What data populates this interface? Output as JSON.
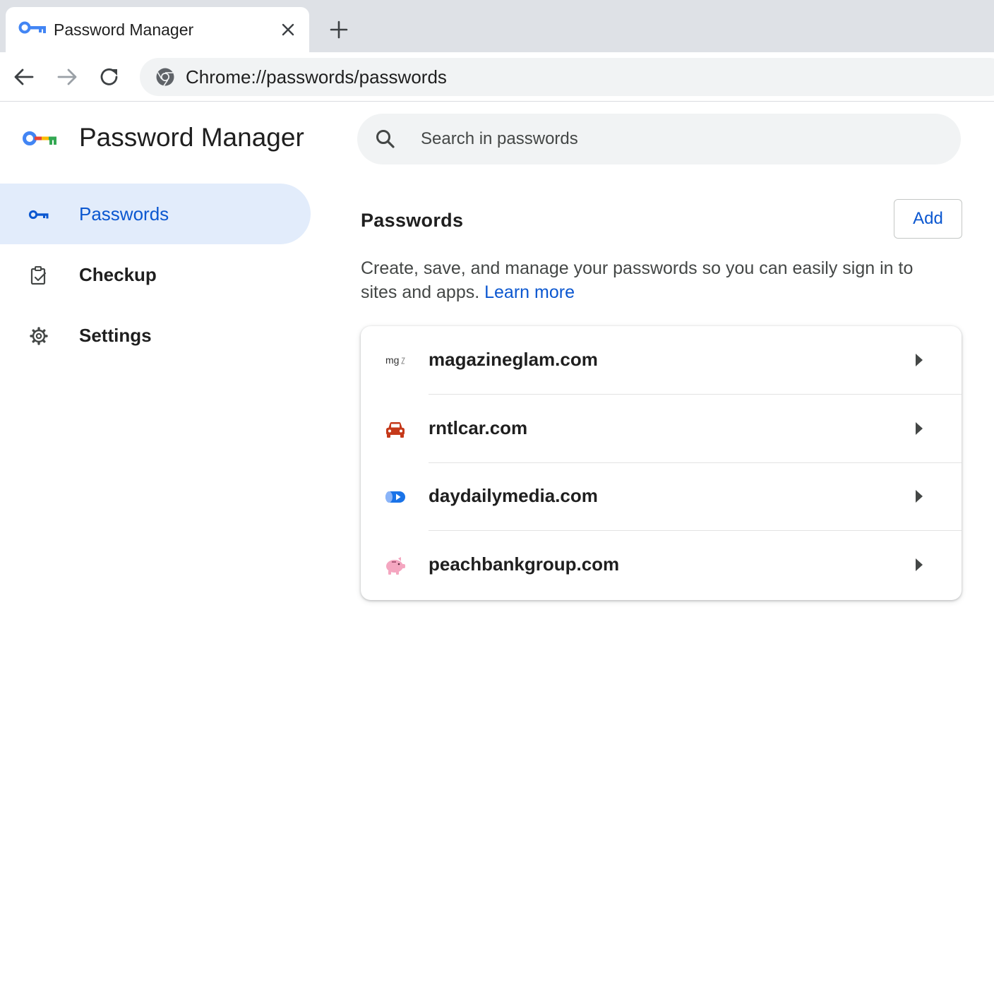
{
  "browser": {
    "tab": {
      "title": "Password Manager",
      "favicon": "key-icon"
    },
    "new_tab_icon": "plus-icon",
    "close_icon": "close-icon",
    "nav": {
      "back": "arrow-left-icon",
      "forward": "arrow-right-icon",
      "reload": "reload-icon"
    },
    "address_bar": {
      "url": "Chrome://passwords/passwords",
      "icon": "chrome-icon"
    }
  },
  "app": {
    "title": "Password Manager",
    "logo": "password-manager-logo-icon"
  },
  "sidebar": {
    "items": [
      {
        "label": "Passwords",
        "icon": "key-icon",
        "active": true
      },
      {
        "label": "Checkup",
        "icon": "checkup-clipboard-icon",
        "active": false
      },
      {
        "label": "Settings",
        "icon": "gear-icon",
        "active": false
      }
    ]
  },
  "search": {
    "placeholder": "Search in passwords",
    "value": ""
  },
  "main": {
    "section_title": "Passwords",
    "add_label": "Add",
    "description": "Create, save, and manage your passwords so you can easily sign in to sites and apps.",
    "learn_more": "Learn more",
    "passwords": [
      {
        "site": "magazineglam.com",
        "icon": "magazineglam-logo-icon",
        "icon_text": "mg"
      },
      {
        "site": "rntlcar.com",
        "icon": "car-icon"
      },
      {
        "site": "daydailymedia.com",
        "icon": "play-pill-icon"
      },
      {
        "site": "peachbankgroup.com",
        "icon": "piggy-bank-icon"
      }
    ]
  },
  "colors": {
    "accent": "#0b57d0",
    "active_bg": "#e2ecfb",
    "tabstrip": "#dee1e6",
    "omnibox": "#f1f3f4",
    "car": "#c5391a",
    "pig": "#f4a6c0",
    "media_blue": "#1a73e8"
  }
}
